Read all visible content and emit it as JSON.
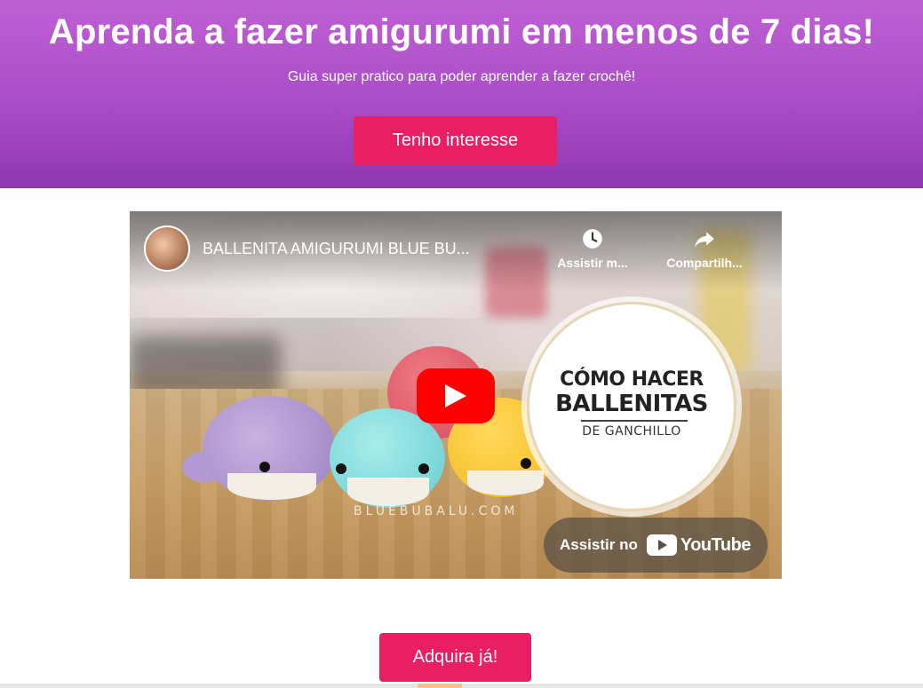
{
  "hero": {
    "title": "Aprenda a fazer amigurumi em menos de 7 dias!",
    "subtitle": "Guia super pratico para poder aprender a fazer crochê!",
    "cta_label": "Tenho interesse",
    "gradient_top": "#c05fd4",
    "gradient_bottom": "#8f37b0"
  },
  "video": {
    "title": "BALLENITA AMIGURUMI BLUE BU...",
    "watch_later_label": "Assistir m...",
    "share_label": "Compartilh...",
    "badge_line1": "CÓMO HACER",
    "badge_line2": "BALLENITAS",
    "badge_line3": "DE GANCHILLO",
    "watermark": "BLUEBUBALU.COM",
    "watch_on_label": "Assistir no",
    "youtube_wordmark": "YouTube",
    "icons": [
      "clock-icon",
      "share-icon",
      "play-icon",
      "youtube-logo-icon"
    ]
  },
  "bottom": {
    "cta_label": "Adquira já!"
  },
  "colors": {
    "cta": "#e91e63",
    "youtube_red": "#ff0000"
  }
}
